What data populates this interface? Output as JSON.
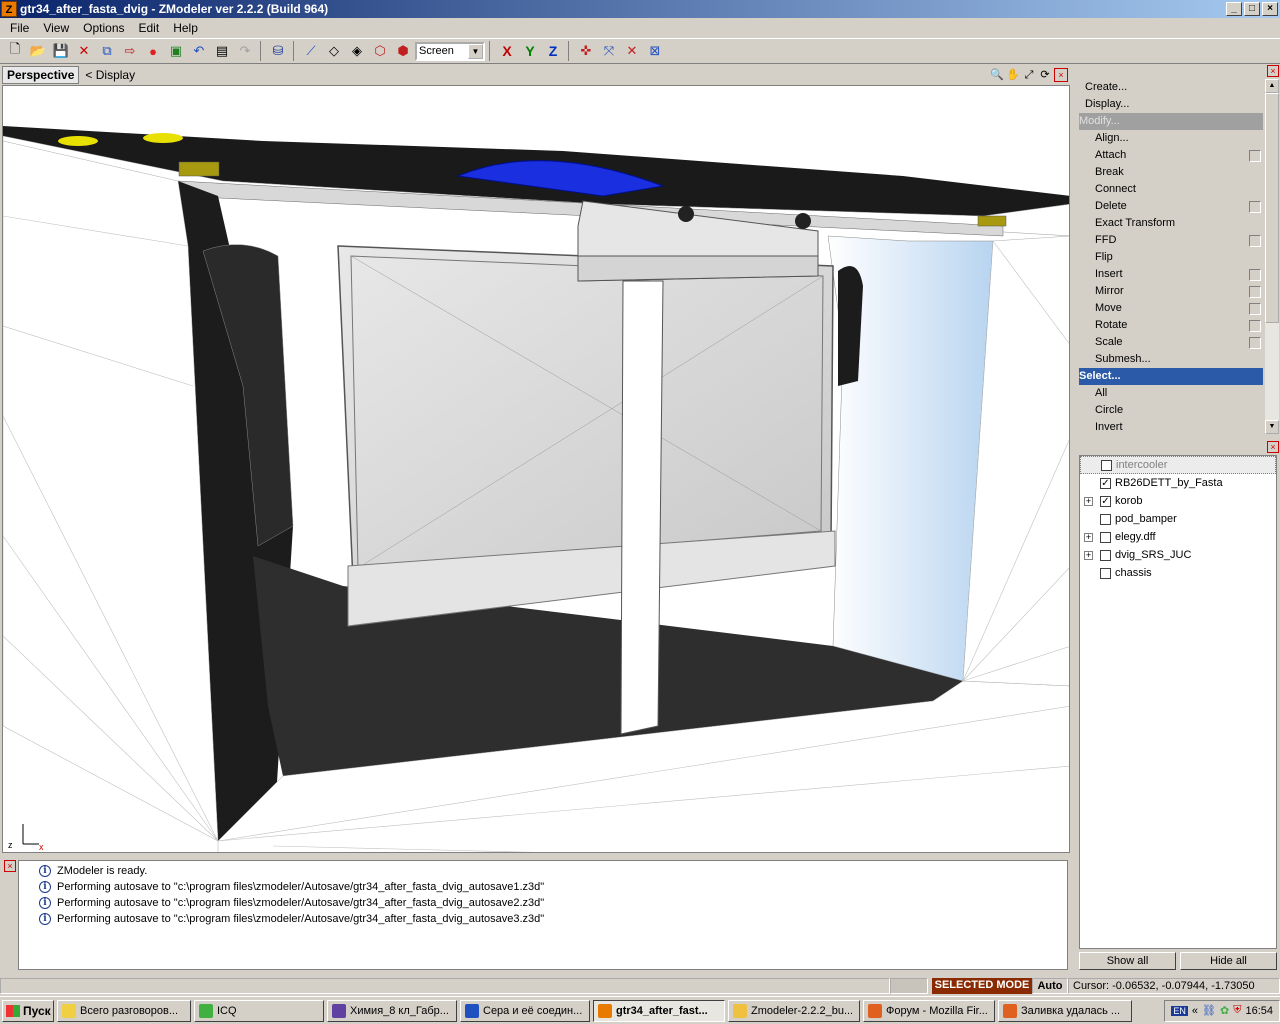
{
  "window": {
    "title": "gtr34_after_fasta_dvig - ZModeler ver 2.2.2 (Build 964)",
    "app_icon_letter": "Z",
    "minimize": "_",
    "maximize": "□",
    "close": "×"
  },
  "menu": [
    "File",
    "View",
    "Options",
    "Edit",
    "Help"
  ],
  "toolbar": {
    "coord_mode": "Screen",
    "axes": [
      "X",
      "Y",
      "Z"
    ],
    "axis_colors": [
      "#c00000",
      "#008000",
      "#0030c0"
    ]
  },
  "viewport": {
    "name": "Perspective",
    "display_label": "<  Display",
    "gizmo": {
      "z": "z",
      "x": "x"
    }
  },
  "command_panel": {
    "items": [
      {
        "label": "Create...",
        "kind": "top"
      },
      {
        "label": "Display...",
        "kind": "top"
      },
      {
        "label": "Modify...",
        "kind": "disabled"
      },
      {
        "label": "Align...",
        "kind": "sub",
        "box": false
      },
      {
        "label": "Attach",
        "kind": "sub",
        "box": true
      },
      {
        "label": "Break",
        "kind": "sub",
        "box": false
      },
      {
        "label": "Connect",
        "kind": "sub",
        "box": false
      },
      {
        "label": "Delete",
        "kind": "sub",
        "box": true
      },
      {
        "label": "Exact Transform",
        "kind": "sub",
        "box": false
      },
      {
        "label": "FFD",
        "kind": "sub",
        "box": true
      },
      {
        "label": "Flip",
        "kind": "sub",
        "box": false
      },
      {
        "label": "Insert",
        "kind": "sub",
        "box": true
      },
      {
        "label": "Mirror",
        "kind": "sub",
        "box": true
      },
      {
        "label": "Move",
        "kind": "sub",
        "box": true
      },
      {
        "label": "Rotate",
        "kind": "sub",
        "box": true
      },
      {
        "label": "Scale",
        "kind": "sub",
        "box": true
      },
      {
        "label": "Submesh...",
        "kind": "sub",
        "box": false
      },
      {
        "label": "Select...",
        "kind": "sel"
      },
      {
        "label": "All",
        "kind": "sub",
        "box": false
      },
      {
        "label": "Circle",
        "kind": "sub",
        "box": false
      },
      {
        "label": "Invert",
        "kind": "sub",
        "box": false
      }
    ]
  },
  "objects": {
    "items": [
      {
        "name": "intercooler",
        "checked": false,
        "expandable": false,
        "dim": true
      },
      {
        "name": "RB26DETT_by_Fasta",
        "checked": true,
        "expandable": false,
        "dim": false
      },
      {
        "name": "korob",
        "checked": true,
        "expandable": true,
        "dim": false
      },
      {
        "name": "pod_bamper",
        "checked": false,
        "expandable": false,
        "dim": false
      },
      {
        "name": "elegy.dff",
        "checked": false,
        "expandable": true,
        "dim": false
      },
      {
        "name": "dvig_SRS_JUC",
        "checked": false,
        "expandable": true,
        "dim": false
      },
      {
        "name": "chassis",
        "checked": false,
        "expandable": false,
        "dim": false
      }
    ],
    "show_all": "Show all",
    "hide_all": "Hide all"
  },
  "log": [
    "ZModeler is ready.",
    "Performing autosave to \"c:\\program files\\zmodeler/Autosave/gtr34_after_fasta_dvig_autosave1.z3d\"",
    "Performing autosave to \"c:\\program files\\zmodeler/Autosave/gtr34_after_fasta_dvig_autosave2.z3d\"",
    "Performing autosave to \"c:\\program files\\zmodeler/Autosave/gtr34_after_fasta_dvig_autosave3.z3d\""
  ],
  "status": {
    "mode": "SELECTED MODE",
    "auto": "Auto",
    "cursor": "Cursor: -0.06532, -0.07944, -1.73050"
  },
  "taskbar": {
    "start": "Пуск",
    "tasks": [
      {
        "label": "Всего разговоров...",
        "color": "#f0d040",
        "active": false
      },
      {
        "label": "ICQ",
        "color": "#40b040",
        "active": false
      },
      {
        "label": "Химия_8 кл_Габр...",
        "color": "#6040a0",
        "active": false
      },
      {
        "label": "Сера и её соедин...",
        "color": "#2050c0",
        "active": false
      },
      {
        "label": "gtr34_after_fast...",
        "color": "#e87a00",
        "active": true
      },
      {
        "label": "Zmodeler-2.2.2_bu...",
        "color": "#f0c040",
        "active": false
      },
      {
        "label": "Форум - Mozilla Fir...",
        "color": "#e06020",
        "active": false
      },
      {
        "label": "Заливка удалась ...",
        "color": "#e06020",
        "active": false
      }
    ],
    "lang": "EN",
    "chevron": "«",
    "clock": "16:54"
  }
}
